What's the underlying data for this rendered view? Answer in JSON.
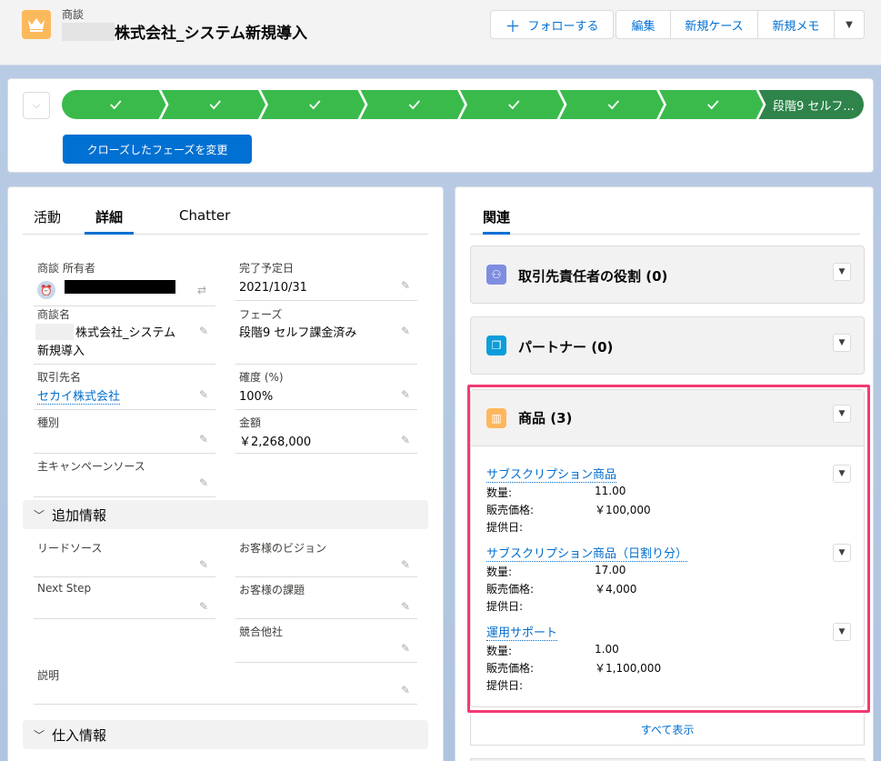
{
  "header": {
    "object_type": "商談",
    "record_name_suffix": "株式会社_システム新規導入",
    "follow_button": "フォローする",
    "actions": [
      {
        "label": "編集",
        "name": "edit-button"
      },
      {
        "label": "新規ケース",
        "name": "new-case-button"
      },
      {
        "label": "新規メモ",
        "name": "new-note-button"
      }
    ]
  },
  "path": {
    "current_stage": "段階9 セルフ...",
    "close_button": "クローズしたフェーズを変更",
    "completed_count": 7
  },
  "detail": {
    "tabs": [
      "活動",
      "詳細",
      "Chatter"
    ],
    "active_tab": "詳細",
    "fields": {
      "owner_label": "商談 所有者",
      "close_date_label": "完了予定日",
      "close_date": "2021/10/31",
      "opp_name_label": "商談名",
      "opp_name_line1": "株式会社_システム",
      "opp_name_line2": "新規導入",
      "stage_label": "フェーズ",
      "stage": "段階9 セルフ課金済み",
      "account_label": "取引先名",
      "account": "セカイ株式会社",
      "probability_label": "確度 (%)",
      "probability": "100%",
      "type_label": "種別",
      "amount_label": "金額",
      "amount": "￥2,268,000",
      "campaign_label": "主キャンペーンソース"
    },
    "additional_section": "追加情報",
    "additional": {
      "lead_source": "リードソース",
      "vision": "お客様のビジョン",
      "next_step": "Next Step",
      "issue": "お客様の課題",
      "competitor": "競合他社",
      "description": "説明"
    },
    "purchase_section": "仕入情報"
  },
  "related": {
    "tab": "関連",
    "contact_roles": "取引先責任者の役割 (0)",
    "partners": "パートナー (0)",
    "products_title": "商品 (3)",
    "qty_label": "数量:",
    "price_label": "販売価格:",
    "date_label": "提供日:",
    "products": [
      {
        "name": "サブスクリプション商品",
        "qty": "11.00",
        "price": "￥100,000"
      },
      {
        "name": "サブスクリプション商品（日割り分）",
        "qty": "17.00",
        "price": "￥4,000"
      },
      {
        "name": "運用サポート",
        "qty": "1.00",
        "price": "￥1,100,000"
      }
    ],
    "view_all": "すべて表示"
  },
  "colors": {
    "path_complete": "#3bba4c",
    "path_current": "#2e844a",
    "brand": "#0070d2",
    "highlight": "#f23a71"
  }
}
